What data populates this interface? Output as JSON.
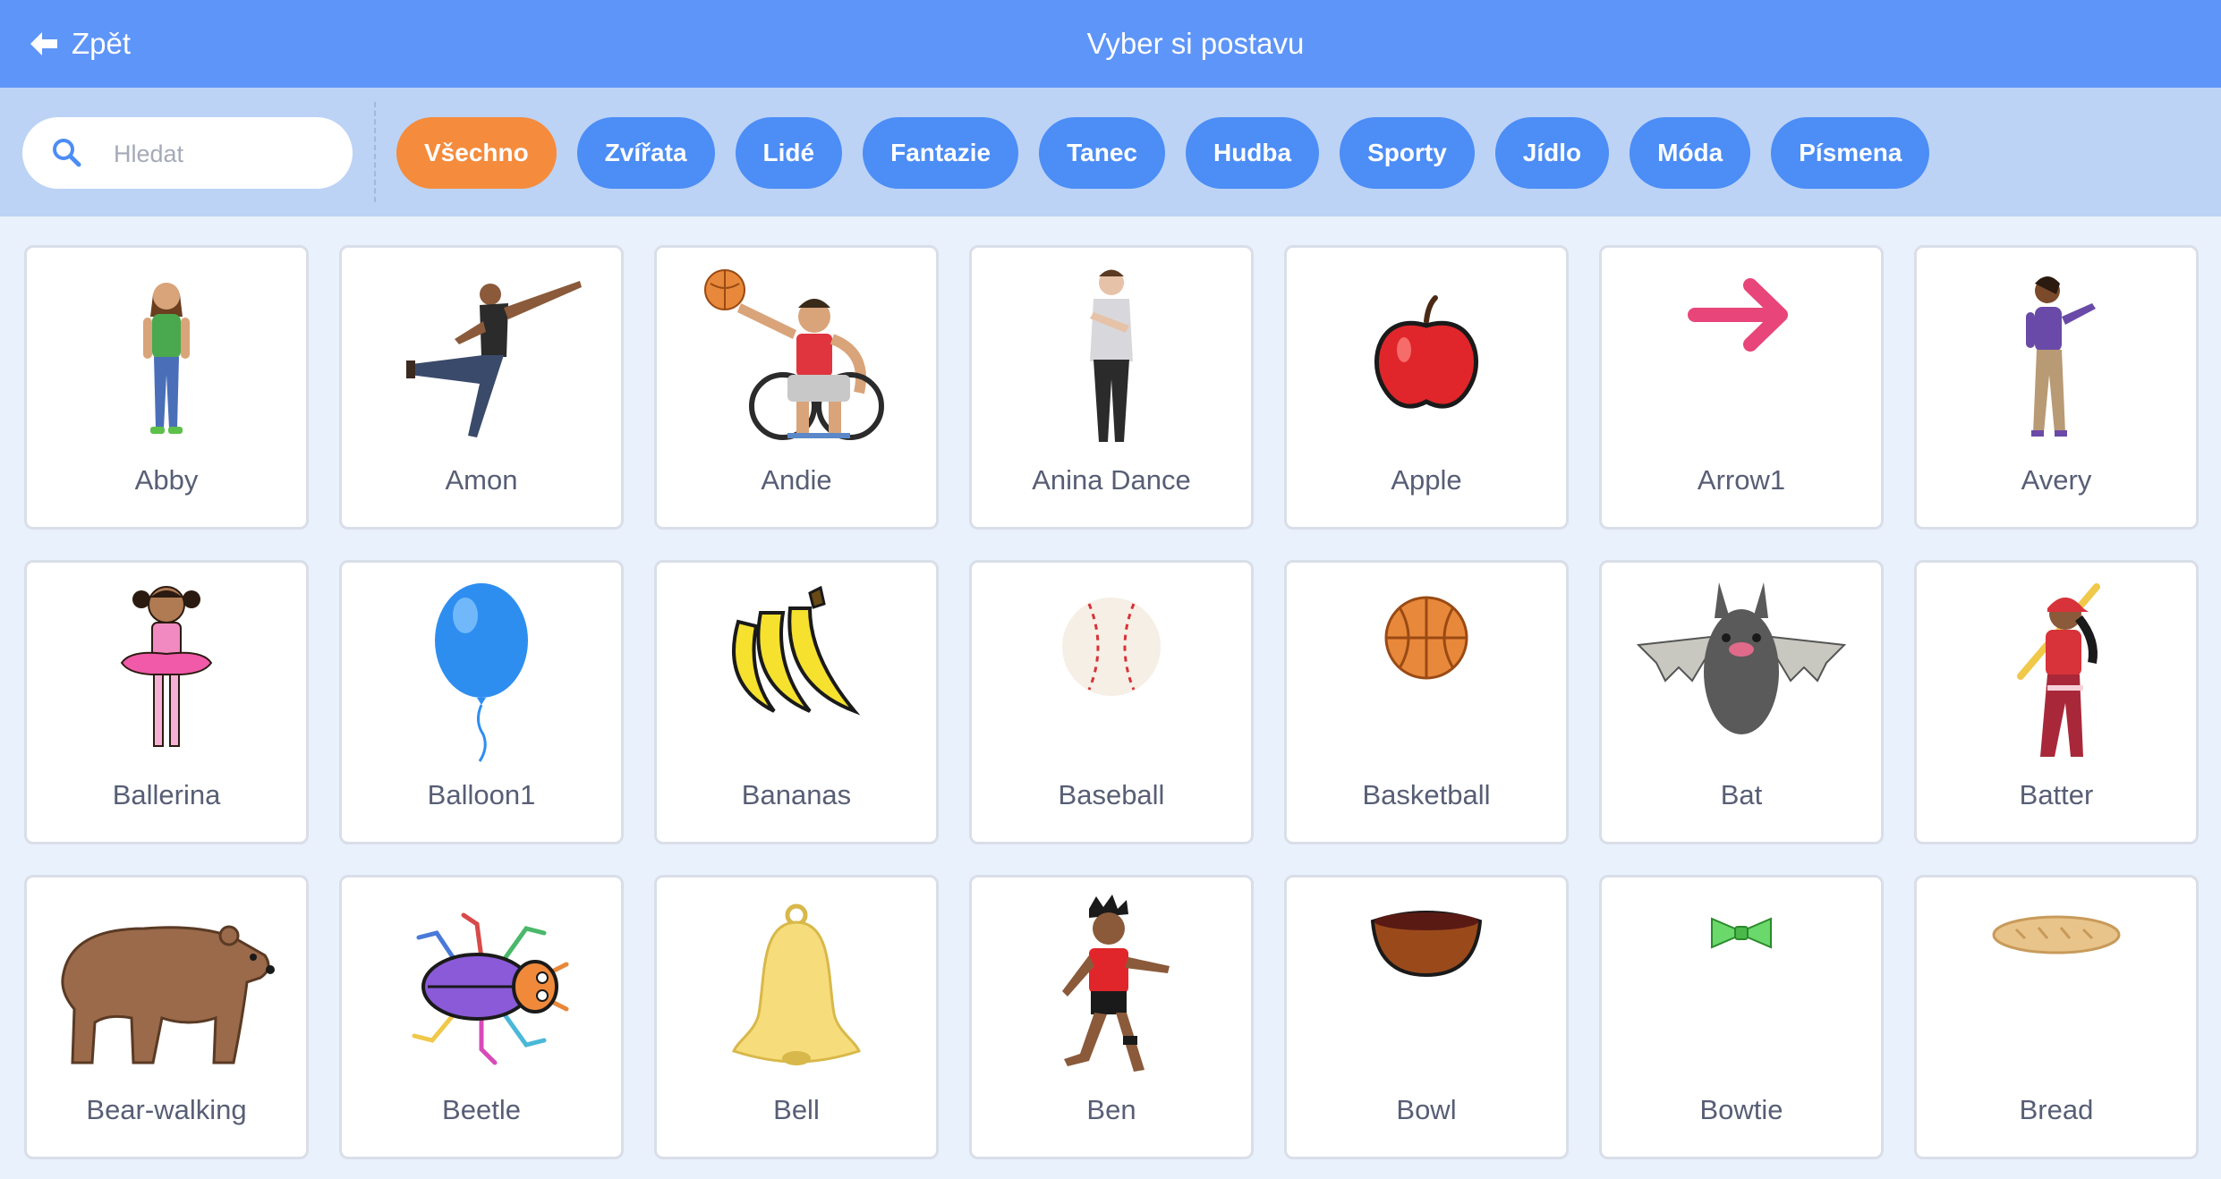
{
  "header": {
    "back_label": "Zpět",
    "title": "Vyber si postavu"
  },
  "search": {
    "placeholder": "Hledat"
  },
  "tags": [
    {
      "label": "Všechno",
      "active": true
    },
    {
      "label": "Zvířata"
    },
    {
      "label": "Lidé"
    },
    {
      "label": "Fantazie"
    },
    {
      "label": "Tanec"
    },
    {
      "label": "Hudba"
    },
    {
      "label": "Sporty"
    },
    {
      "label": "Jídlo"
    },
    {
      "label": "Móda"
    },
    {
      "label": "Písmena"
    }
  ],
  "sprites": [
    {
      "name": "Abby",
      "icon": "abby-icon"
    },
    {
      "name": "Amon",
      "icon": "amon-icon"
    },
    {
      "name": "Andie",
      "icon": "andie-icon"
    },
    {
      "name": "Anina Dance",
      "icon": "anina-dance-icon"
    },
    {
      "name": "Apple",
      "icon": "apple-icon"
    },
    {
      "name": "Arrow1",
      "icon": "arrow1-icon"
    },
    {
      "name": "Avery",
      "icon": "avery-icon"
    },
    {
      "name": "Ballerina",
      "icon": "ballerina-icon"
    },
    {
      "name": "Balloon1",
      "icon": "balloon1-icon"
    },
    {
      "name": "Bananas",
      "icon": "bananas-icon"
    },
    {
      "name": "Baseball",
      "icon": "baseball-icon"
    },
    {
      "name": "Basketball",
      "icon": "basketball-icon"
    },
    {
      "name": "Bat",
      "icon": "bat-icon"
    },
    {
      "name": "Batter",
      "icon": "batter-icon"
    },
    {
      "name": "Bear-walking",
      "icon": "bear-walking-icon"
    },
    {
      "name": "Beetle",
      "icon": "beetle-icon"
    },
    {
      "name": "Bell",
      "icon": "bell-icon"
    },
    {
      "name": "Ben",
      "icon": "ben-icon"
    },
    {
      "name": "Bowl",
      "icon": "bowl-icon"
    },
    {
      "name": "Bowtie",
      "icon": "bowtie-icon"
    },
    {
      "name": "Bread",
      "icon": "bread-icon"
    }
  ],
  "colors": {
    "header": "#5e95f8",
    "filterbar": "#bcd3f6",
    "tag": "#4c8df6",
    "tag_active": "#f58b3c",
    "page": "#e9f1fc",
    "text": "#575e75"
  }
}
